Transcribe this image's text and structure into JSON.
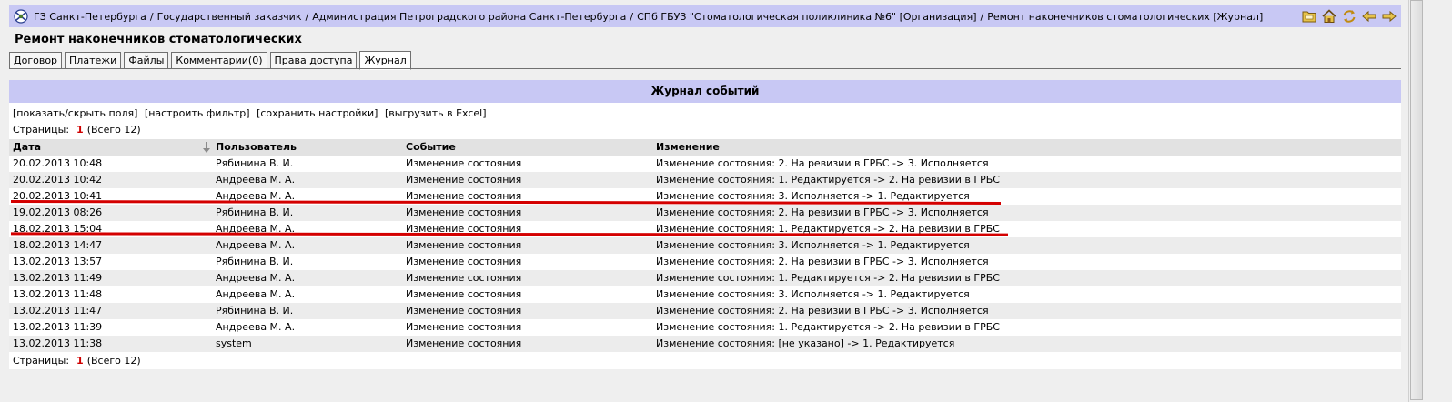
{
  "breadcrumb": [
    "ГЗ Санкт-Петербурга",
    "Государственный заказчик",
    "Администрация Петроградского района Санкт-Петербурга",
    "СПб ГБУЗ \"Стоматологическая поликлиника №6\" [Организация]",
    "Ремонт наконечников стоматологических [Журнал]"
  ],
  "breadcrumb_separator": "/",
  "top_icons": [
    "folder-icon",
    "home-icon",
    "refresh-icon",
    "back-arrow-icon",
    "forward-arrow-icon"
  ],
  "page_title": "Ремонт наконечников стоматологических",
  "tabs": [
    "Договор",
    "Платежи",
    "Файлы",
    "Комментарии(0)",
    "Права доступа",
    "Журнал"
  ],
  "active_tab": "Журнал",
  "panel_title": "Журнал событий",
  "actions": [
    "[показать/скрыть поля]",
    "[настроить фильтр]",
    "[сохранить настройки]",
    "[выгрузить в Excel]"
  ],
  "pager": {
    "label": "Страницы:",
    "current": "1",
    "total": "(Всего 12)"
  },
  "table": {
    "columns": [
      "Дата",
      "Пользователь",
      "Событие",
      "Изменение"
    ],
    "rows": [
      [
        "20.02.2013 10:48",
        "Рябинина В. И.",
        "Изменение состояния",
        "Изменение состояния: 2. На ревизии в ГРБС -> 3. Исполняется"
      ],
      [
        "20.02.2013 10:42",
        "Андреева М. А.",
        "Изменение состояния",
        "Изменение состояния: 1. Редактируется -> 2. На ревизии в ГРБС"
      ],
      [
        "20.02.2013 10:41",
        "Андреева М. А.",
        "Изменение состояния",
        "Изменение состояния: 3. Исполняется -> 1. Редактируется"
      ],
      [
        "19.02.2013 08:26",
        "Рябинина В. И.",
        "Изменение состояния",
        "Изменение состояния: 2. На ревизии в ГРБС -> 3. Исполняется"
      ],
      [
        "18.02.2013 15:04",
        "Андреева М. А.",
        "Изменение состояния",
        "Изменение состояния: 1. Редактируется -> 2. На ревизии в ГРБС"
      ],
      [
        "18.02.2013 14:47",
        "Андреева М. А.",
        "Изменение состояния",
        "Изменение состояния: 3. Исполняется -> 1. Редактируется"
      ],
      [
        "13.02.2013 13:57",
        "Рябинина В. И.",
        "Изменение состояния",
        "Изменение состояния: 2. На ревизии в ГРБС -> 3. Исполняется"
      ],
      [
        "13.02.2013 11:49",
        "Андреева М. А.",
        "Изменение состояния",
        "Изменение состояния: 1. Редактируется -> 2. На ревизии в ГРБС"
      ],
      [
        "13.02.2013 11:48",
        "Андреева М. А.",
        "Изменение состояния",
        "Изменение состояния: 3. Исполняется -> 1. Редактируется"
      ],
      [
        "13.02.2013 11:47",
        "Рябинина В. И.",
        "Изменение состояния",
        "Изменение состояния: 2. На ревизии в ГРБС -> 3. Исполняется"
      ],
      [
        "13.02.2013 11:39",
        "Андреева М. А.",
        "Изменение состояния",
        "Изменение состояния: 1. Редактируется -> 2. На ревизии в ГРБС"
      ],
      [
        "13.02.2013 11:38",
        "system",
        "Изменение состояния",
        "Изменение состояния: [не указано] -> 1. Редактируется"
      ]
    ]
  },
  "colors": {
    "header_band": "#c8c8f4",
    "annotation_line": "#d40000",
    "pager_number": "#d00000"
  }
}
